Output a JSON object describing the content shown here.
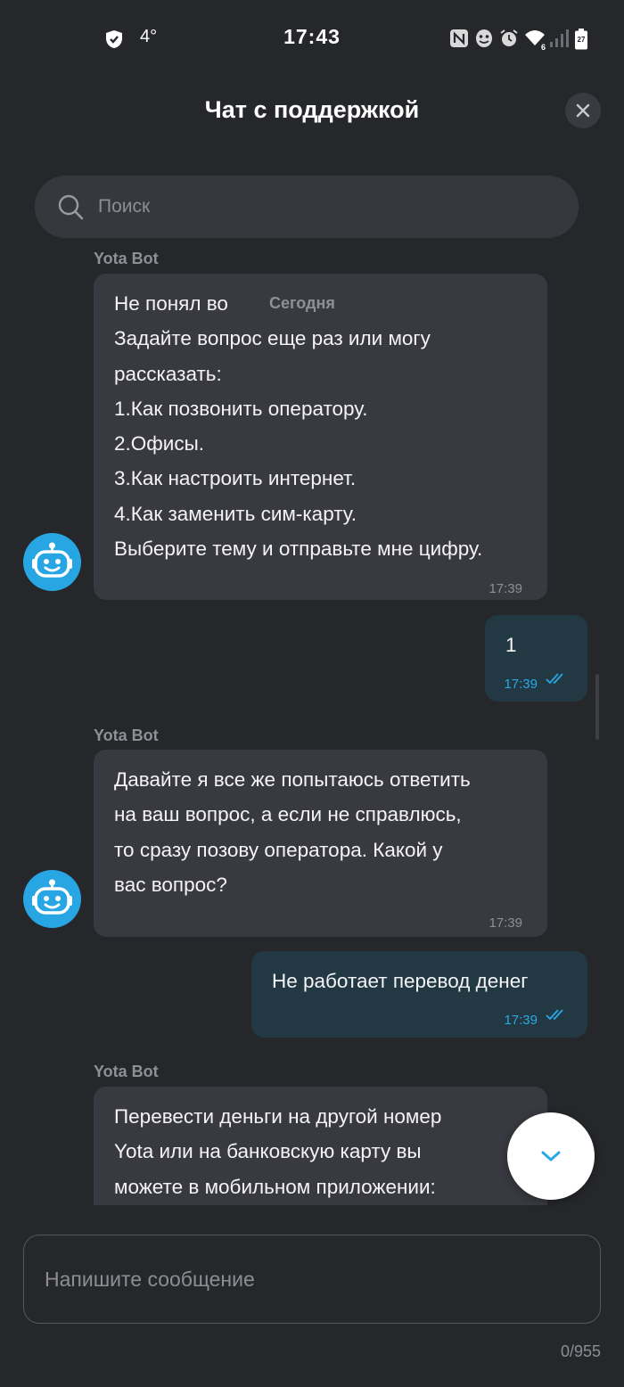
{
  "status_bar": {
    "time": "17:43",
    "temperature": "4°",
    "icons": [
      "shield-icon",
      "nfc-icon",
      "mask-icon",
      "alarm-icon",
      "wifi-icon",
      "signal-icon",
      "battery-icon"
    ],
    "wifi_badge": "6",
    "battery_level": "27"
  },
  "header": {
    "title": "Чат с поддержкой",
    "close_icon": "close-icon"
  },
  "search": {
    "placeholder": "Поиск"
  },
  "chat": {
    "date_divider": "Сегодня",
    "messages": [
      {
        "from": "bot",
        "sender": "Yota Bot",
        "lines": [
          "Не понял во",
          "Задайте вопрос еще раз или могу",
          "рассказать:",
          "1.Как позвонить оператору.",
          "2.Офисы.",
          "3.Как настроить интернет.",
          "4.Как заменить сим-карту.",
          "Выберите тему и отправьте мне цифру."
        ],
        "time": "17:39"
      },
      {
        "from": "user",
        "text": "1",
        "time": "17:39",
        "status": "read"
      },
      {
        "from": "bot",
        "sender": "Yota Bot",
        "lines": [
          "Давайте я все же попытаюсь ответить",
          "на ваш вопрос, а если не справлюсь,",
          "то сразу позову оператора. Какой у",
          "вас вопрос?"
        ],
        "time": "17:39"
      },
      {
        "from": "user",
        "text": "Не работает перевод денег",
        "time": "17:39",
        "status": "read"
      },
      {
        "from": "bot",
        "sender": "Yota Bot",
        "lines": [
          "Перевести деньги на другой номер",
          "Yota или на банковскую карту вы",
          "можете в мобильном приложении:"
        ]
      }
    ]
  },
  "composer": {
    "placeholder": "Напишите сообщение",
    "counter": "0/955"
  },
  "colors": {
    "background": "#26272b",
    "bot_bubble": "#393a41",
    "user_bubble": "#223843",
    "accent": "#2aa8e5",
    "avatar": "#27a6e3"
  }
}
